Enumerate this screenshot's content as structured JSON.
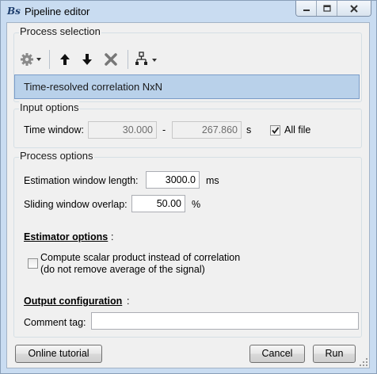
{
  "window": {
    "title": "Pipeline editor",
    "app_icon_text": "Bs"
  },
  "process_selection": {
    "legend": "Process selection",
    "toolbar_icons": [
      "gear-icon",
      "arrow-up-icon",
      "arrow-down-icon",
      "delete-icon",
      "tree-icon"
    ],
    "selected_process": "Time-resolved correlation NxN"
  },
  "input_options": {
    "legend": "Input options",
    "time_window_label": "Time window:",
    "time_start": "30.000",
    "time_dash": "-",
    "time_end": "267.860",
    "time_unit": "s",
    "all_file_label": "All file",
    "all_file_checked": true
  },
  "process_options": {
    "legend": "Process options",
    "estimation_label": "Estimation window length:",
    "estimation_value": "3000.0",
    "estimation_unit": "ms",
    "sliding_label": "Sliding window overlap:",
    "sliding_value": "50.00",
    "sliding_unit": "%",
    "estimator_header": "Estimator options",
    "estimator_colon": ":",
    "scalar_line1": "Compute scalar product instead of correlation",
    "scalar_line2": "(do not remove average of the signal)",
    "scalar_checked": false,
    "output_header": "Output configuration",
    "output_colon": ":",
    "comment_label": "Comment tag:",
    "comment_value": ""
  },
  "buttons": {
    "online_tutorial": "Online tutorial",
    "cancel": "Cancel",
    "run": "Run"
  }
}
